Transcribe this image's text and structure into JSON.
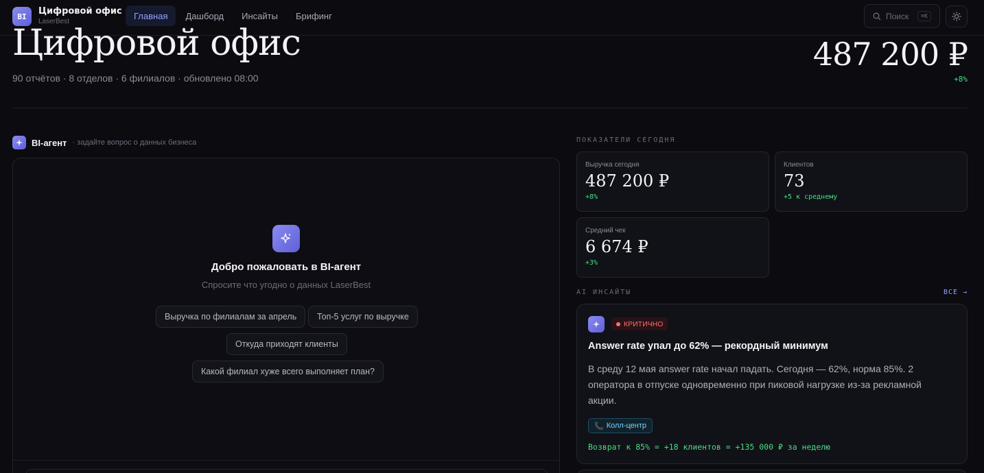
{
  "brand": {
    "logo": "BI",
    "title": "Цифровой офис",
    "subtitle": "LaserBest"
  },
  "nav": [
    "Главная",
    "Дашборд",
    "Инсайты",
    "Брифинг"
  ],
  "search": {
    "label": "Поиск",
    "shortcut": "⌘K"
  },
  "hero": {
    "title": "Цифровой офис",
    "subtitle": "90 отчётов · 8 отделов · 6 филиалов · обновлено 08:00",
    "value": "487 200 ₽",
    "delta": "+8%"
  },
  "agent": {
    "title": "BI-агент",
    "subtitle": "· задайте вопрос о данных бизнеса",
    "welcome_title": "Добро пожаловать в BI-агент",
    "welcome_sub": "Спросите что угодно о данных LaserBest",
    "suggestions": [
      "Выручка по филиалам за апрель",
      "Топ-5 услуг по выручке",
      "Откуда приходят клиенты",
      "Какой филиал хуже всего выполняет план?"
    ]
  },
  "metrics": {
    "section_label": "ПОКАЗАТЕЛИ СЕГОДНЯ",
    "cards": [
      {
        "label": "Выручка сегодня",
        "value": "487 200 ₽",
        "delta": "+8%"
      },
      {
        "label": "Клиентов",
        "value": "73",
        "delta": "+5 к среднему"
      },
      {
        "label": "Средний чек",
        "value": "6 674 ₽",
        "delta": "+3%"
      }
    ]
  },
  "insights": {
    "section_label": "AI ИНСАЙТЫ",
    "all_link": "ВСЕ →",
    "items": [
      {
        "badge": "КРИТИЧНО",
        "title": "Answer rate упал до 62% — рекордный минимум",
        "body": "В среду 12 мая answer rate начал падать. Сегодня — 62%, норма 85%. 2 оператора в отпуске одновременно при пиковой нагрузке из-за рекламной акции.",
        "tag": "Колл-центр",
        "result": "Возврат к 85% = +18 клиентов = +135 000 ₽ за неделю"
      }
    ]
  },
  "colors": {
    "accent": "#8fa3ff",
    "positive": "#4ade80",
    "critical": "#f87171",
    "background": "#0b0b10"
  }
}
